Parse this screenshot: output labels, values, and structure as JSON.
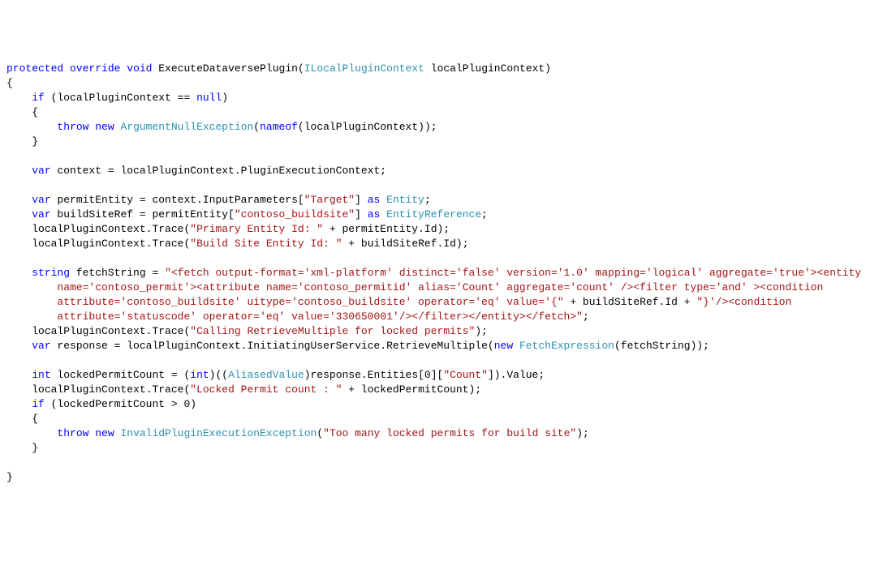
{
  "code": {
    "l1": {
      "kw1": "protected",
      "kw2": "override",
      "kw3": "void",
      "method": "ExecuteDataversePlugin",
      "type": "ILocalPluginContext",
      "param": "localPluginContext",
      "close": ")"
    },
    "l2": {
      "brace": "{"
    },
    "l3": {
      "kw": "if",
      "cond": "(localPluginContext == ",
      "kwnull": "null",
      "close": ")"
    },
    "l4": {
      "brace": "{"
    },
    "l5": {
      "kw1": "throw",
      "kw2": "new",
      "type": "ArgumentNullException",
      "open": "(",
      "kwnameof": "nameof",
      "args": "(localPluginContext));"
    },
    "l6": {
      "brace": "}"
    },
    "l7": {
      "kw": "var",
      "txt": " context = localPluginContext.PluginExecutionContext;"
    },
    "l8": {
      "kw": "var",
      "txt1": " permitEntity = context.InputParameters[",
      "str": "\"Target\"",
      "txt2": "] ",
      "kwas": "as",
      "sp": " ",
      "type": "Entity",
      "semi": ";"
    },
    "l9": {
      "kw": "var",
      "txt1": " buildSiteRef = permitEntity[",
      "str": "\"contoso_buildsite\"",
      "txt2": "] ",
      "kwas": "as",
      "sp": " ",
      "type": "EntityReference",
      "semi": ";"
    },
    "l10": {
      "txt1": "localPluginContext.Trace(",
      "str": "\"Primary Entity Id: \"",
      "txt2": " + permitEntity.Id);"
    },
    "l11": {
      "txt1": "localPluginContext.Trace(",
      "str": "\"Build Site Entity Id: \"",
      "txt2": " + buildSiteRef.Id);"
    },
    "l12": {
      "kw": "string",
      "txt": " fetchString = ",
      "str": "\"<fetch output-format='xml-platform' distinct='false' version='1.0' mapping='logical' aggregate='true'><entity "
    },
    "l12b": {
      "str": "name='contoso_permit'><attribute name='contoso_permitid' alias='Count' aggregate='count' /><filter type='and' ><condition "
    },
    "l12c": {
      "str1": "attribute='contoso_buildsite' uitype='contoso_buildsite' operator='eq' value='{\"",
      "txt": " + buildSiteRef.Id + ",
      "str2": "\"}'/><condition "
    },
    "l12d": {
      "str": "attribute='statuscode' operator='eq' value='330650001'/></filter></entity></fetch>\"",
      "semi": ";"
    },
    "l13": {
      "txt1": "localPluginContext.Trace(",
      "str": "\"Calling RetrieveMultiple for locked permits\"",
      "txt2": ");"
    },
    "l14": {
      "kw": "var",
      "txt": " response = localPluginContext.InitiatingUserService.RetrieveMultiple(",
      "kwnew": "new",
      "sp": " ",
      "type": "FetchExpression",
      "args": "(fetchString));"
    },
    "l15": {
      "kw": "int",
      "txt1": " lockedPermitCount = (",
      "kwint": "int",
      "txt2": ")((",
      "type": "AliasedValue",
      "txt3": ")response.Entities[0][",
      "str": "\"Count\"",
      "txt4": "]).Value;"
    },
    "l16": {
      "txt1": "localPluginContext.Trace(",
      "str": "\"Locked Permit count : \"",
      "txt2": " + lockedPermitCount);"
    },
    "l17": {
      "kw": "if",
      "txt": " (lockedPermitCount > 0)"
    },
    "l18": {
      "brace": "{"
    },
    "l19": {
      "kw1": "throw",
      "kw2": "new",
      "type": "InvalidPluginExecutionException",
      "open": "(",
      "str": "\"Too many locked permits for build site\"",
      "close": ");"
    },
    "l20": {
      "brace": "}"
    },
    "l21": {
      "brace": "}"
    }
  }
}
